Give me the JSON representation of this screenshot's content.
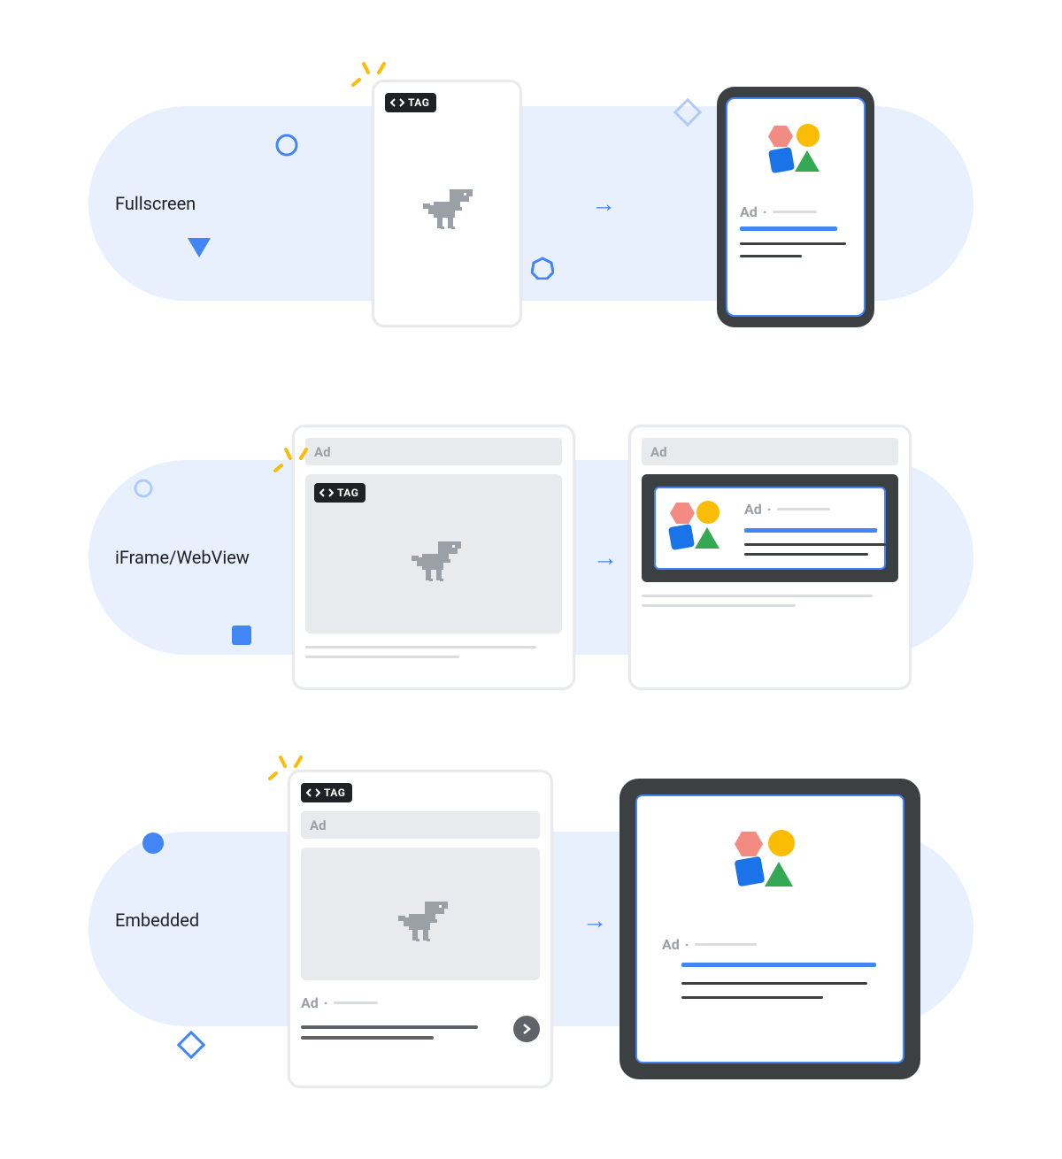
{
  "rows": {
    "fullscreen": {
      "label": "Fullscreen"
    },
    "iframe": {
      "label": "iFrame/WebView"
    },
    "embedded": {
      "label": "Embedded"
    }
  },
  "tag_badge": "TAG",
  "ad_label": "Ad",
  "ad_inline": "Ad ·",
  "colors": {
    "blue": "#4285f4",
    "lightblue": "#e8f0fe",
    "yellow": "#fbbc04",
    "green": "#34a853",
    "darkgrey": "#3c4043",
    "paleblue": "#aecbfa"
  }
}
